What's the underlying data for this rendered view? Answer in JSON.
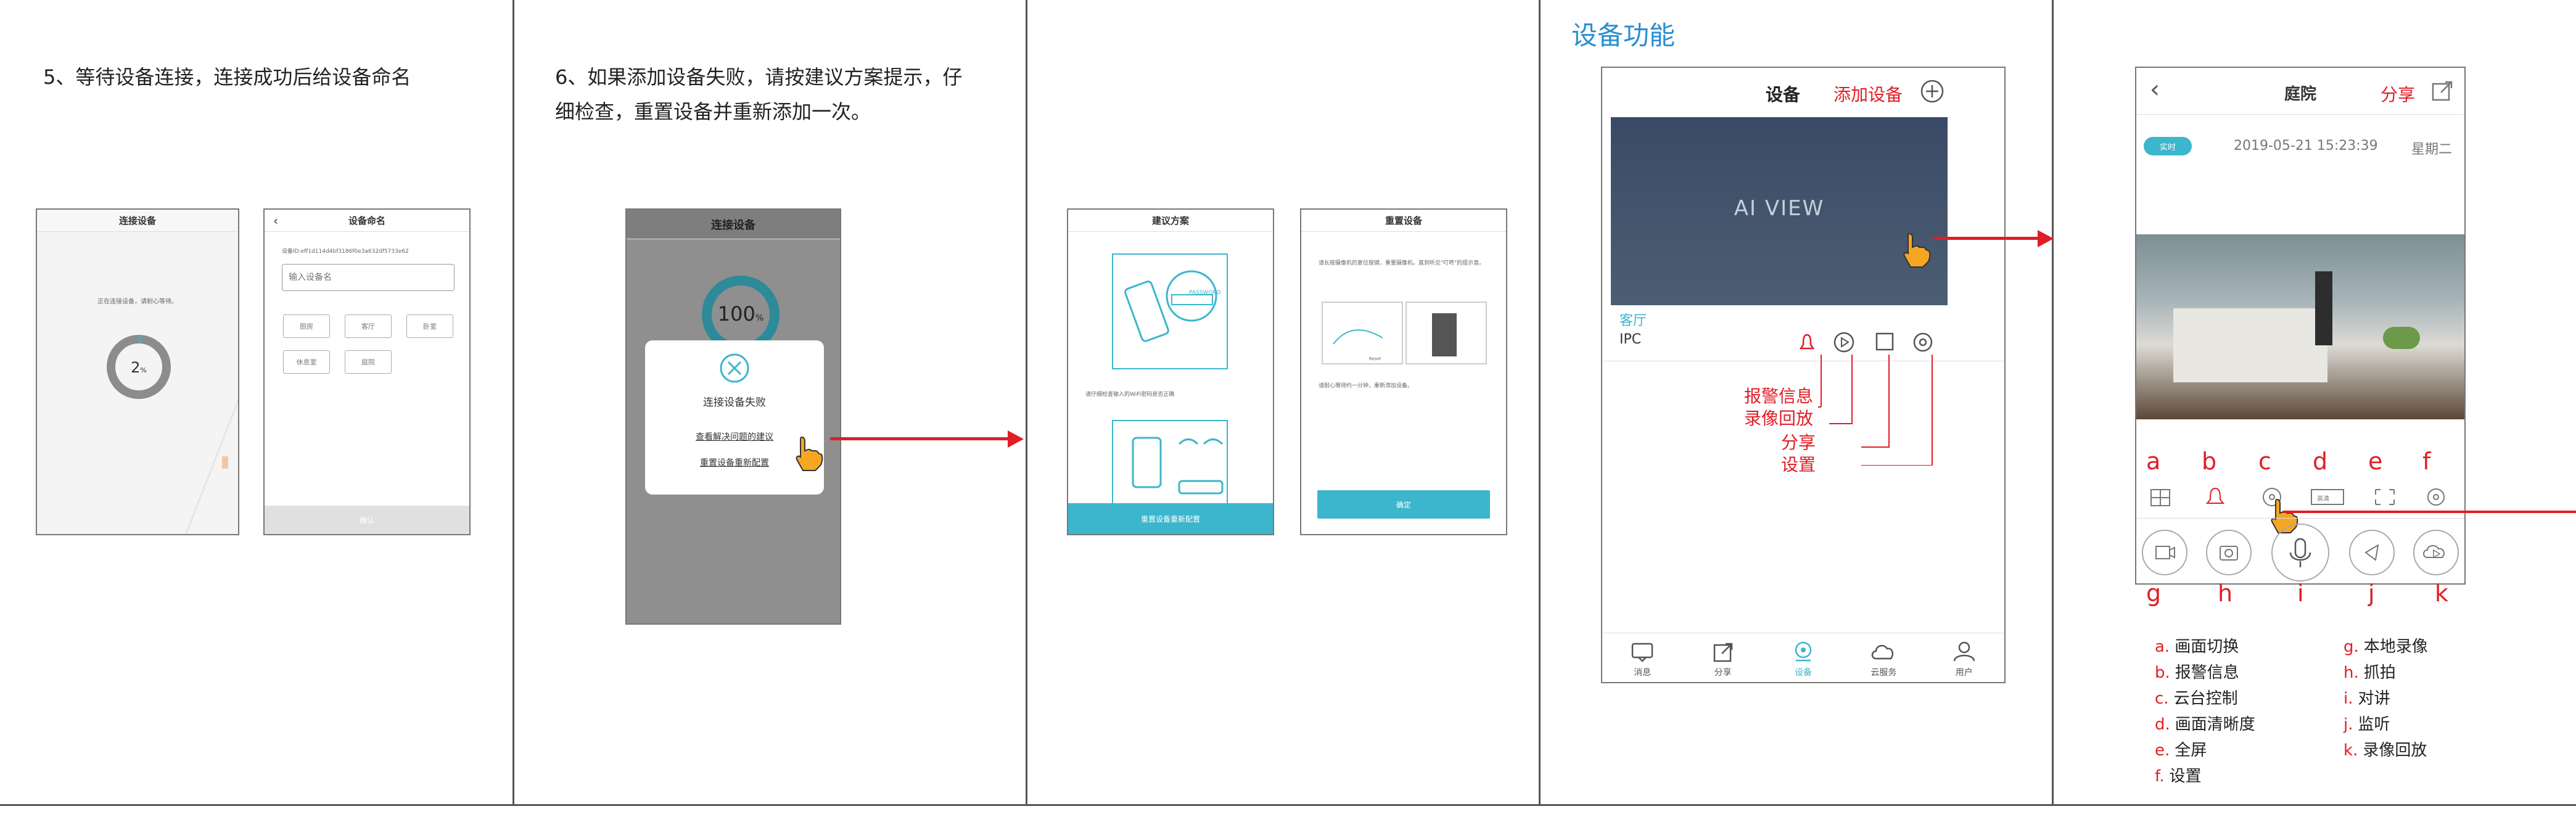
{
  "panel1": {
    "step": "5、等待设备连接，连接成功后给设备命名",
    "connect": {
      "title": "连接设备",
      "waiting": "正在连接设备，请耐心等待。",
      "progress_text": "2",
      "progress_unit": "%",
      "progress_value": 0.02
    },
    "naming": {
      "title": "设备命名",
      "device_id": "设备ID:eff1d114d4bf3186f0e3a632df5733e62",
      "placeholder": "输入设备名",
      "chips": [
        "厨房",
        "客厅",
        "卧室",
        "休息室",
        "庭院"
      ],
      "confirm": "确认"
    }
  },
  "panel2": {
    "step_line1": "6、如果添加设备失败，请按建议方案提示，仔",
    "step_line2": "细检查，重置设备并重新添加一次。",
    "title": "连接设备",
    "progress_text": "100",
    "progress_unit": "%",
    "fail_text": "连接设备失败",
    "link1": "查看解决问题的建议",
    "link2": "重置设备重新配置"
  },
  "panel3": {
    "suggest": {
      "title": "建议方案",
      "password": "PASSWORD",
      "hint": "请仔细检查输入的WiFi密码是否正确",
      "bottom": "重置设备重新配置"
    },
    "reset": {
      "title": "重置设备",
      "text1": "请长按摄像机的复位按键，重置摄像机。直到听见\"叮咚\"的提示音。",
      "reset_label": "Reset",
      "text2": "请耐心等待约一分钟，重新添加设备。",
      "confirm": "确定"
    }
  },
  "panel4": {
    "heading": "设备功能",
    "app": {
      "title": "设备",
      "add": "添加设备",
      "preview": "AI VIEW",
      "room": "客厅",
      "type": "IPC",
      "annotations": [
        "报警信息",
        "录像回放",
        "分享",
        "设置"
      ],
      "tabs": [
        "消息",
        "分享",
        "设备",
        "云服务",
        "用户"
      ]
    }
  },
  "panel5": {
    "title": "庭院",
    "share": "分享",
    "live": "实时",
    "datetime": "2019-05-21 15:23:39",
    "weekday": "星期二",
    "hd": "高清",
    "top_letters": [
      "a",
      "b",
      "c",
      "d",
      "e",
      "f"
    ],
    "bottom_letters": [
      "g",
      "h",
      "i",
      "j",
      "k"
    ],
    "legend_left": [
      {
        "k": "a.",
        "v": "画面切换"
      },
      {
        "k": "b.",
        "v": "报警信息"
      },
      {
        "k": "c.",
        "v": "云台控制"
      },
      {
        "k": "d.",
        "v": "画面清晰度"
      },
      {
        "k": "e.",
        "v": "全屏"
      },
      {
        "k": "f.",
        "v": "设置"
      }
    ],
    "legend_right": [
      {
        "k": "g.",
        "v": "本地录像"
      },
      {
        "k": "h.",
        "v": "抓拍"
      },
      {
        "k": "i.",
        "v": "对讲"
      },
      {
        "k": "j.",
        "v": "监听"
      },
      {
        "k": "k.",
        "v": "录像回放"
      }
    ]
  },
  "colors": {
    "accent": "#3bb6cc",
    "red": "#e01e25",
    "title_blue": "#2a8fd0"
  }
}
